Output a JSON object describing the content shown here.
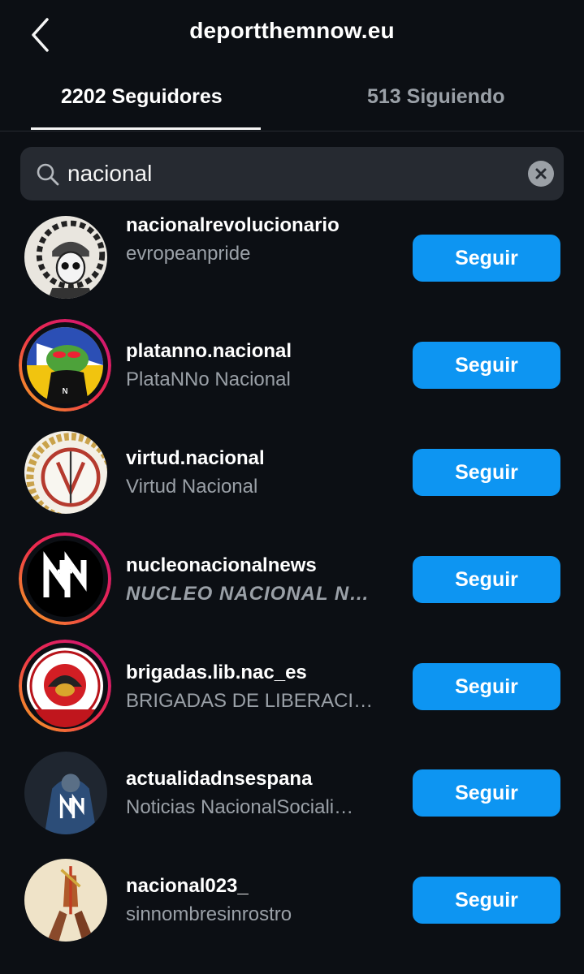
{
  "header": {
    "title": "deportthemnow.eu"
  },
  "tabs": [
    {
      "label": "2202 Seguidores",
      "active": true
    },
    {
      "label": "513 Siguiendo",
      "active": false
    }
  ],
  "search": {
    "value": "nacional",
    "icon": "search-icon",
    "clear_icon": "clear-icon"
  },
  "accounts": [
    {
      "username": "nacionalrevolucionario",
      "name": "evropeanpride",
      "button": "Seguir"
    },
    {
      "username": "platanno.nacional",
      "name": "PlataNNo Nacional",
      "button": "Seguir"
    },
    {
      "username": "virtud.nacional",
      "name": "Virtud Nacional",
      "button": "Seguir"
    },
    {
      "username": "nucleonacionalnews",
      "name": "NUCLEO NACIONAL NEWS…",
      "button": "Seguir"
    },
    {
      "username": "brigadas.lib.nac_es",
      "name": "BRIGADAS DE LIBERACI…",
      "button": "Seguir"
    },
    {
      "username": "actualidadnsespana",
      "name": "Noticias NacionalSociali…",
      "button": "Seguir"
    },
    {
      "username": "nacional023_",
      "name": "sinnombresinrostro",
      "button": "Seguir"
    }
  ],
  "colors": {
    "background": "#0c0f14",
    "accent": "#0d95f2",
    "story_ring_start": "#f5a623",
    "story_ring_end": "#d3136b"
  }
}
